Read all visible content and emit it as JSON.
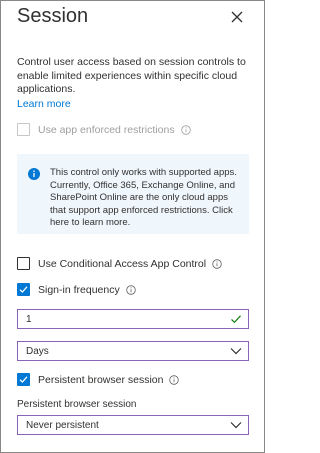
{
  "panel": {
    "title": "Session",
    "description": "Control user access based on session controls to enable limited experiences within specific cloud applications.",
    "learn_more": "Learn more"
  },
  "options": {
    "app_enforced": {
      "label": "Use app enforced restrictions",
      "checked": false,
      "disabled": true
    },
    "info_text": "This control only works with supported apps. Currently, Office 365, Exchange Online, and SharePoint Online are the only cloud apps that support app enforced restrictions. Click here to learn more.",
    "conditional_access": {
      "label": "Use Conditional Access App Control",
      "checked": false
    },
    "signin_frequency": {
      "label": "Sign-in frequency",
      "checked": true,
      "value": "1",
      "unit": "Days"
    },
    "persistent_browser": {
      "label": "Persistent browser session",
      "checked": true,
      "select_label": "Persistent browser session",
      "value": "Never persistent"
    }
  },
  "colors": {
    "accent": "#0078d4",
    "focus_border": "#8764b8",
    "valid": "#107c10",
    "info_bg": "#eff6fc"
  },
  "icons": [
    "close-icon",
    "info-circle-icon",
    "checkmark-icon",
    "chevron-down-icon"
  ]
}
